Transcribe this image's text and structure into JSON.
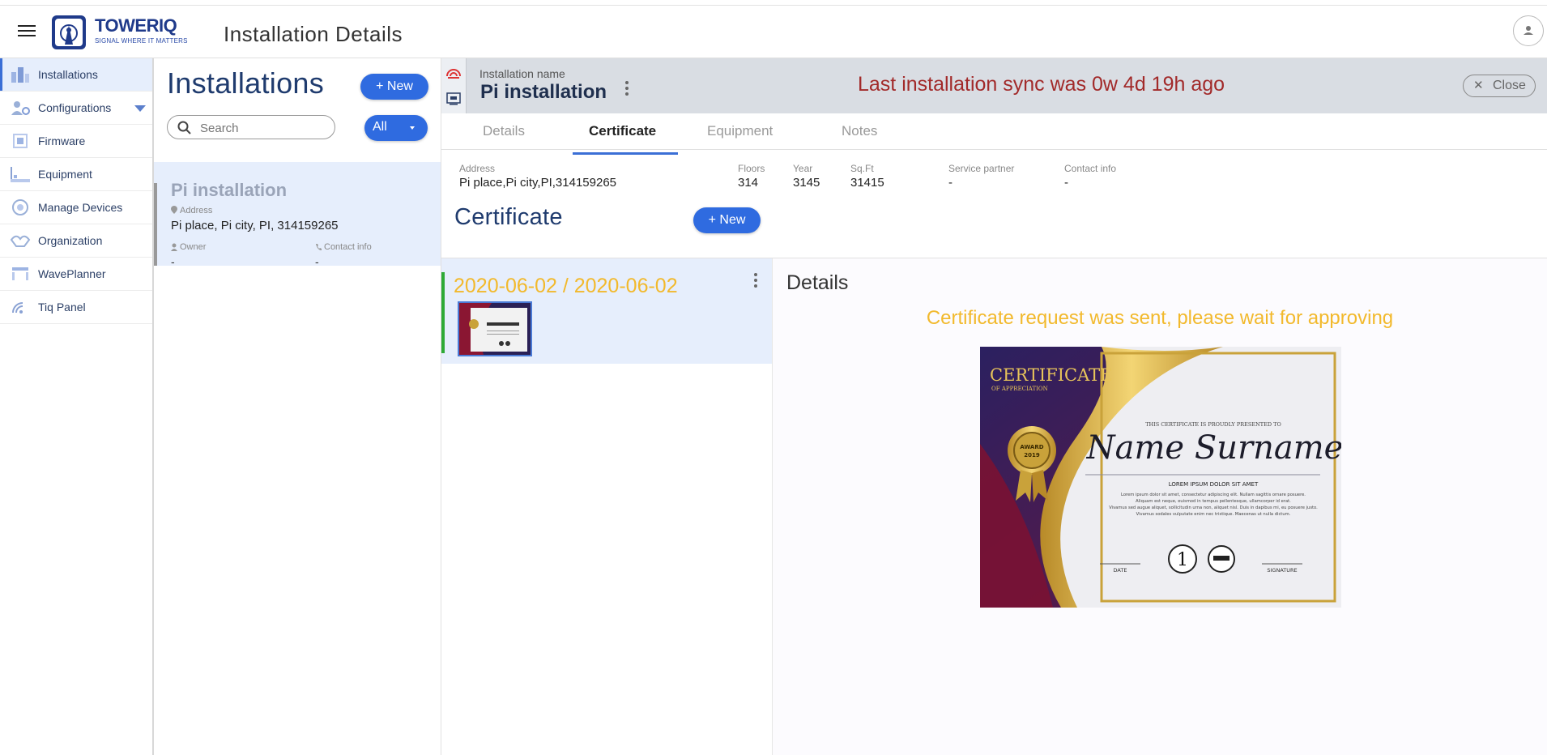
{
  "header": {
    "brand_name": "TOWERIQ",
    "brand_tagline": "SIGNAL WHERE IT MATTERS",
    "page_title": "Installation Details"
  },
  "nav": {
    "items": [
      {
        "label": "Installations"
      },
      {
        "label": "Configurations"
      },
      {
        "label": "Firmware"
      },
      {
        "label": "Equipment"
      },
      {
        "label": "Manage Devices"
      },
      {
        "label": "Organization"
      },
      {
        "label": "WavePlanner"
      },
      {
        "label": "Tiq Panel"
      }
    ]
  },
  "list": {
    "title": "Installations",
    "new_label": "New",
    "search_placeholder": "Search",
    "filter_label": "All",
    "card": {
      "name": "Pi installation",
      "address_label": "Address",
      "address": "Pi place, Pi city, PI, 314159265",
      "owner_label": "Owner",
      "owner": "-",
      "contact_label": "Contact info",
      "contact": "-"
    }
  },
  "detail": {
    "name_label": "Installation name",
    "name": "Pi installation",
    "sync_message": "Last installation sync was 0w 4d 19h ago",
    "close_label": "Close",
    "tabs": [
      {
        "label": "Details"
      },
      {
        "label": "Certificate"
      },
      {
        "label": "Equipment"
      },
      {
        "label": "Notes"
      }
    ],
    "info": {
      "address_label": "Address",
      "address": "Pi place,Pi city,PI,314159265",
      "floors_label": "Floors",
      "floors": "314",
      "year_label": "Year",
      "year": "3145",
      "sqft_label": "Sq.Ft",
      "sqft": "31415",
      "partner_label": "Service partner",
      "partner": "-",
      "contact_label": "Contact info",
      "contact": "-"
    },
    "certificate_title": "Certificate",
    "certificate_new_label": "New",
    "certificates": [
      {
        "dates": "2020-06-02 / 2020-06-02"
      }
    ],
    "details_title": "Details",
    "pending_message": "Certificate request was sent, please wait for approving",
    "certificate_image": {
      "heading": "CERTIFICATE",
      "subheading": "OF APPRECIATION",
      "presented": "THIS CERTIFICATE IS PROUDLY PRESENTED TO",
      "recipient": "Name Surname",
      "lorem_title": "LOREM IPSUM DOLOR SIT AMET",
      "lorem_lines": [
        "Lorem ipsum dolor sit amet, consectetur adipiscing elit. Nullam sagittis ornare posuere.",
        "Aliquam est neque, euismod in tempus pellentesque, ullamcorper id erat.",
        "Vivamus sed augue aliquet, sollicitudin urna non, aliquet nisl. Duis in dapibus mi, eu posuere justo.",
        "Vivamus sodales vulputate enim nec tristique. Maecenas ut nulla dictum."
      ],
      "award_text": "AWARD",
      "award_year": "2019",
      "number": "1",
      "date_label": "DATE",
      "signature_label": "SIGNATURE"
    }
  },
  "colors": {
    "accent": "#2f6be0",
    "sync_text": "#a22a2a",
    "pending": "#f2b92c",
    "selected_bg": "#e6eefc",
    "cert_active_bar": "#2eaa36"
  }
}
